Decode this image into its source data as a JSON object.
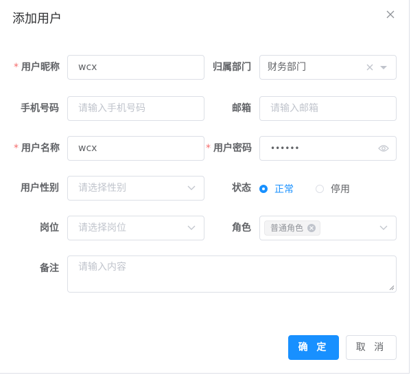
{
  "dialog": {
    "title": "添加用户"
  },
  "form": {
    "nick_name": {
      "label": "用户昵称",
      "value": "wcx"
    },
    "dept": {
      "label": "归属部门",
      "value": "财务部门"
    },
    "phone": {
      "label": "手机号码",
      "placeholder": "请输入手机号码"
    },
    "email": {
      "label": "邮箱",
      "placeholder": "请输入邮箱"
    },
    "user_name": {
      "label": "用户名称",
      "value": "wcx"
    },
    "password": {
      "label": "用户密码",
      "value": "••••••"
    },
    "sex": {
      "label": "用户性别",
      "placeholder": "请选择性别"
    },
    "status": {
      "label": "状态",
      "options": [
        "正常",
        "停用"
      ],
      "selected": "正常"
    },
    "post": {
      "label": "岗位",
      "placeholder": "请选择岗位"
    },
    "role": {
      "label": "角色",
      "tags": [
        "普通角色"
      ]
    },
    "remark": {
      "label": "备注",
      "placeholder": "请输入内容"
    },
    "required_mark": "*"
  },
  "footer": {
    "confirm_label": "确 定",
    "cancel_label": "取 消"
  },
  "colors": {
    "primary": "#1890ff",
    "required": "#f56c6c",
    "border": "#dcdfe6",
    "placeholder": "#c0c4cc"
  },
  "icons": {
    "close": "close-icon",
    "select_arrow": "chevron-down-icon",
    "clear": "clear-icon",
    "password_toggle": "eye-icon",
    "tag_remove": "tag-close-icon",
    "resize": "resize-handle-icon"
  }
}
